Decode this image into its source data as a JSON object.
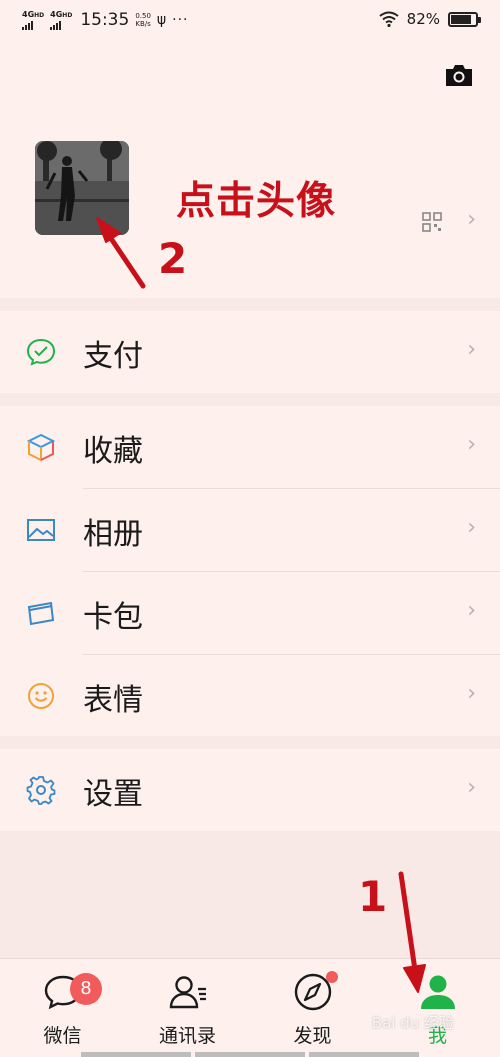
{
  "status_bar": {
    "net1": "4G",
    "net1_sup": "HD",
    "net2": "4G",
    "net2_sup": "HD",
    "time": "15:35",
    "speed_value": "0.50",
    "speed_unit": "KB/s",
    "usb": "ψ",
    "more": "···",
    "battery_percent": "82%",
    "battery_level": 0.82
  },
  "profile": {
    "annotation_text": "点击头像",
    "annotation_number": "2"
  },
  "menu": {
    "pay": {
      "label": "支付",
      "icon": "pay-icon"
    },
    "items": [
      {
        "label": "收藏",
        "icon": "favorites-cube-icon"
      },
      {
        "label": "相册",
        "icon": "album-picture-icon"
      },
      {
        "label": "卡包",
        "icon": "card-wallet-icon"
      },
      {
        "label": "表情",
        "icon": "smiley-face-icon"
      }
    ],
    "settings": {
      "label": "设置",
      "icon": "gear-icon"
    },
    "chevron": "›"
  },
  "tabbar": {
    "tabs": [
      {
        "label": "微信",
        "badge": "8"
      },
      {
        "label": "通讯录"
      },
      {
        "label": "发现"
      },
      {
        "label": "我"
      }
    ],
    "annotation_number": "1"
  },
  "watermark": "Bai du 经验",
  "colors": {
    "accent_green": "#21b24a",
    "annotation_red": "#c8101a",
    "badge_red": "#f25b5b",
    "background": "#fdf0ed"
  }
}
